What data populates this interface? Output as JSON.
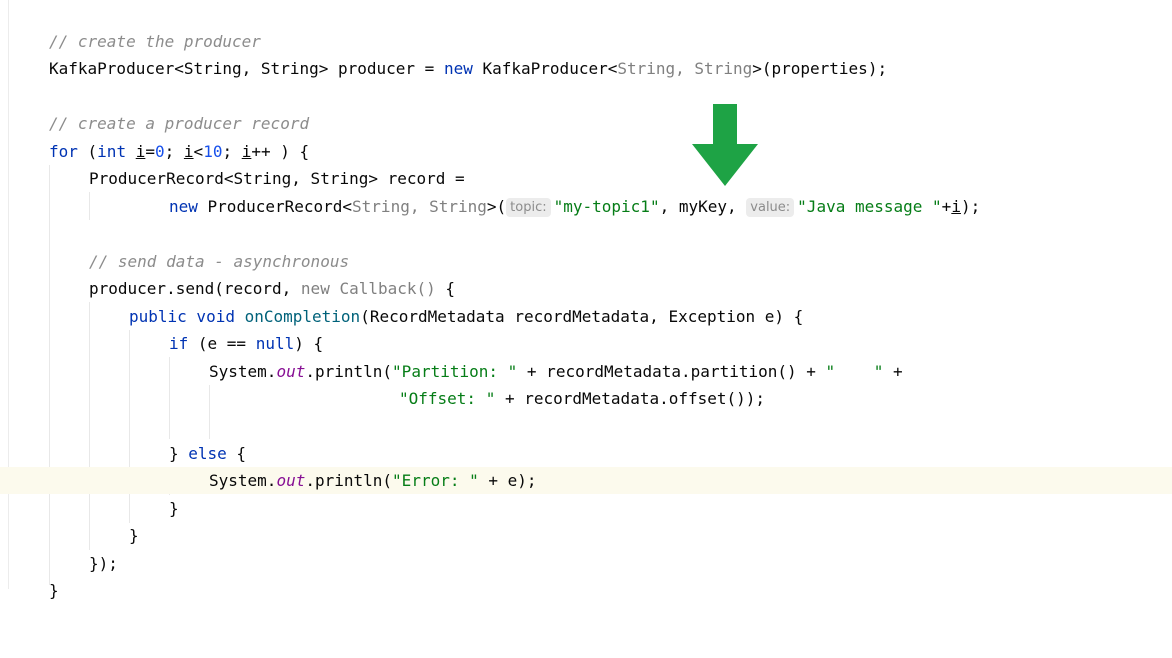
{
  "editor": {
    "arrow_color": "#1ea345",
    "lines": {
      "l01": {
        "cmt": "// create the producer"
      },
      "l02": {
        "a": "KafkaProducer<String, String> producer = ",
        "kw": "new",
        "b": " KafkaProducer<",
        "gen": "String, String",
        "c": ">(properties);"
      },
      "l04": {
        "cmt": "// create a producer record"
      },
      "l05": {
        "kw1": "for",
        "a": " (",
        "kw2": "int",
        "sp": " ",
        "i1": "i",
        "b": "=",
        "n0": "0",
        "c": "; ",
        "i2": "i",
        "d": "<",
        "n10": "10",
        "e": "; ",
        "i3": "i",
        "f": "++ ) {"
      },
      "l06": {
        "a": "ProducerRecord<String, String> record ="
      },
      "l07": {
        "kw": "new",
        "a": " ProducerRecord<",
        "gen": "String, String",
        "b": ">(",
        "hint_topic": "topic:",
        "s1": "\"my-topic1\"",
        "c": ", myKey, ",
        "hint_value": "value:",
        "s2": "\"Java message \"",
        "d": "+",
        "i": "i",
        "e": ");"
      },
      "l09": {
        "cmt": "// send data - asynchronous"
      },
      "l10": {
        "a": "producer.send(record, ",
        "gen": "new Callback()",
        "b": " {"
      },
      "l11": {
        "kw": "public void ",
        "mth": "onCompletion",
        "a": "(RecordMetadata recordMetadata, Exception e) {"
      },
      "l12": {
        "kw1": "if",
        "a": " (e == ",
        "kw2": "null",
        "b": ") {"
      },
      "l13": {
        "a": "System.",
        "fld": "out",
        "b": ".println(",
        "s1": "\"Partition: \"",
        "c": " + recordMetadata.partition() + ",
        "s2": "\"    \"",
        "d": " +"
      },
      "l14": {
        "s": "\"Offset: \"",
        "a": " + recordMetadata.offset());"
      },
      "l16": {
        "a": "} ",
        "kw": "else",
        "b": " {"
      },
      "l17": {
        "a": "System.",
        "fld": "out",
        "b": ".println(",
        "s": "\"Error: \"",
        "c": " + e);"
      },
      "l18": {
        "a": "}"
      },
      "l19": {
        "a": "}"
      },
      "l20": {
        "a": "});"
      },
      "l21": {
        "a": "}"
      }
    }
  }
}
